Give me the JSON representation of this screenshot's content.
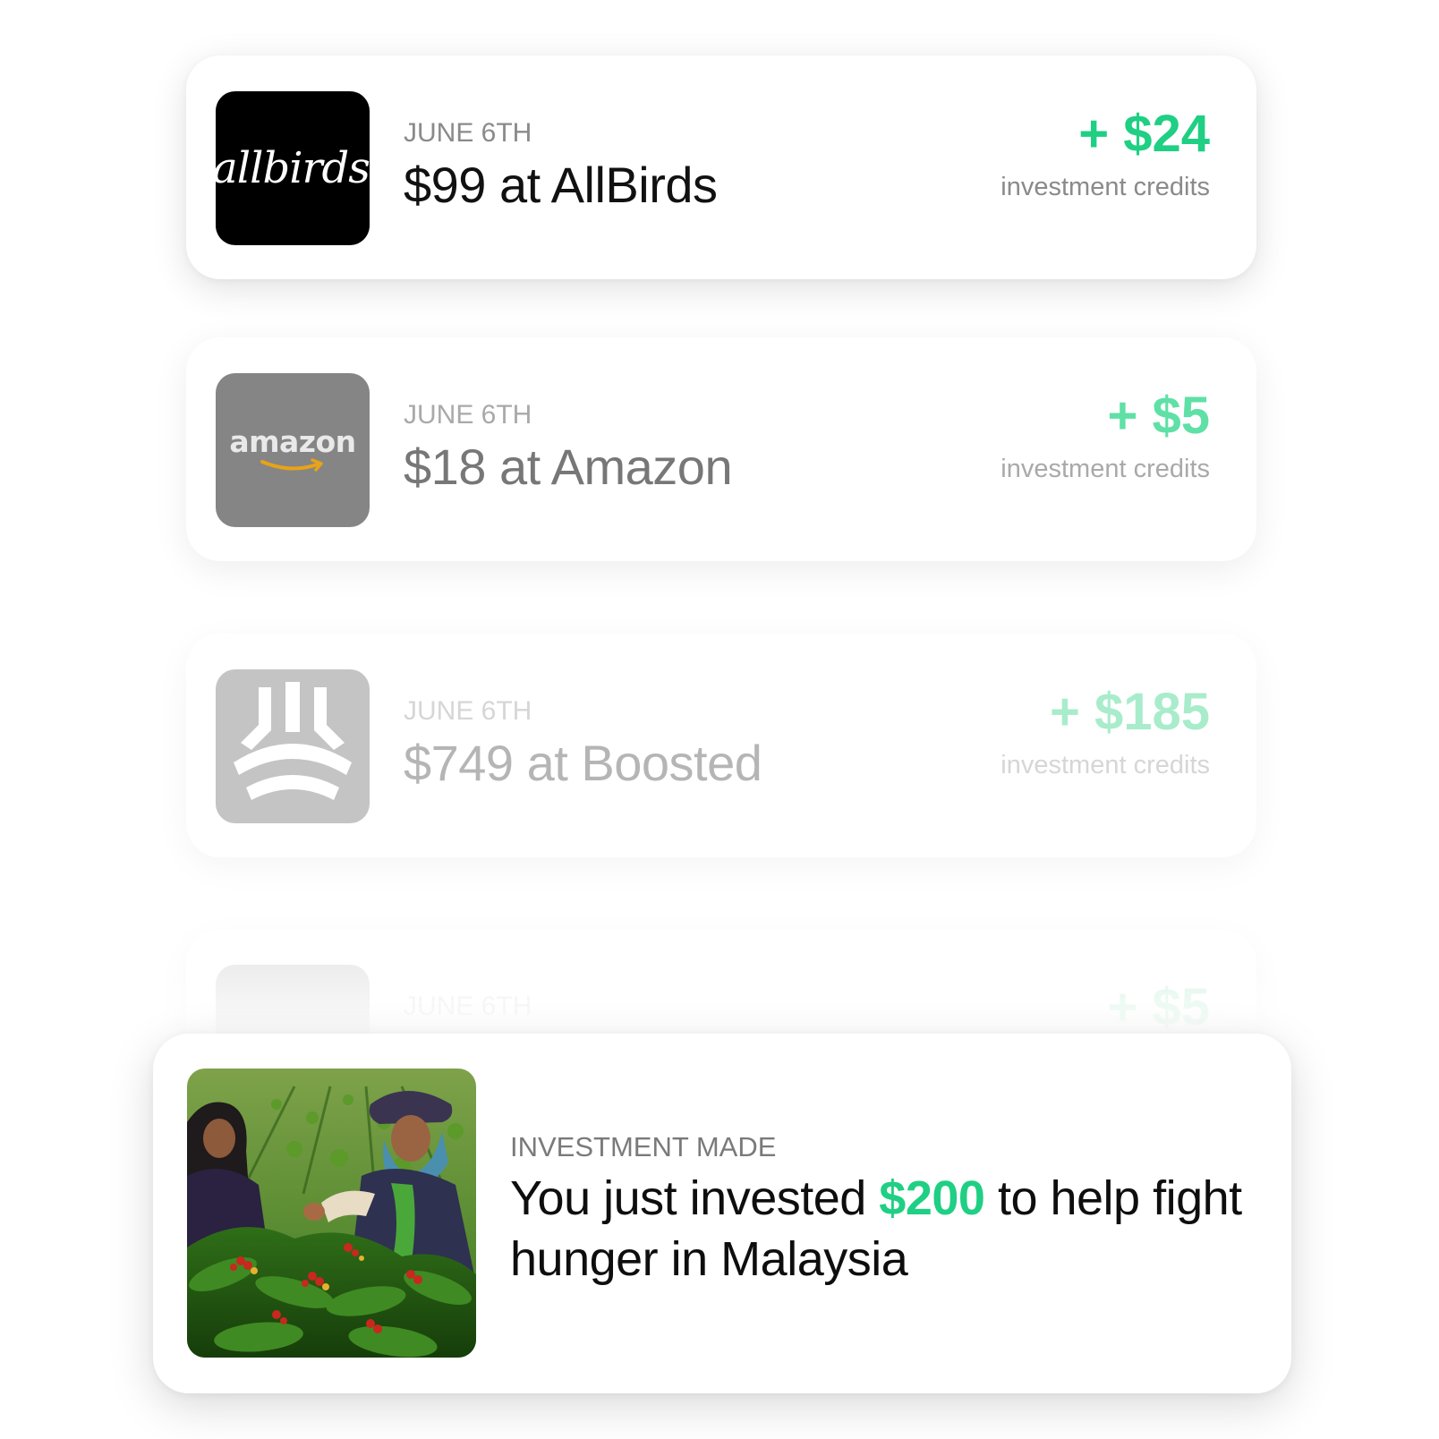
{
  "transactions": [
    {
      "merchant_logo": "allbirds",
      "logo_text": "allbirds",
      "date": "JUNE 6TH",
      "title": "$99 at AllBirds",
      "credit_amount": "+ $24",
      "credit_label": "investment credits"
    },
    {
      "merchant_logo": "amazon",
      "logo_text": "amazon",
      "date": "JUNE 6TH",
      "title": "$18 at Amazon",
      "credit_amount": "+ $5",
      "credit_label": "investment credits"
    },
    {
      "merchant_logo": "boosted",
      "date": "JUNE 6TH",
      "title": "$749 at Boosted",
      "credit_amount": "+ $185",
      "credit_label": "investment credits"
    },
    {
      "merchant_logo": "blank",
      "date": "JUNE 6TH",
      "credit_amount": "+ $5"
    }
  ],
  "notification": {
    "label": "INVESTMENT MADE",
    "text_before": "You just invested ",
    "amount": "$200",
    "text_after": " to help fight hunger in Malaysia",
    "image": "farmers-picking-coffee-photo"
  },
  "colors": {
    "accent_green": "#1fcf83",
    "muted_gray": "#8a8a8a",
    "text_dark": "#111111"
  }
}
